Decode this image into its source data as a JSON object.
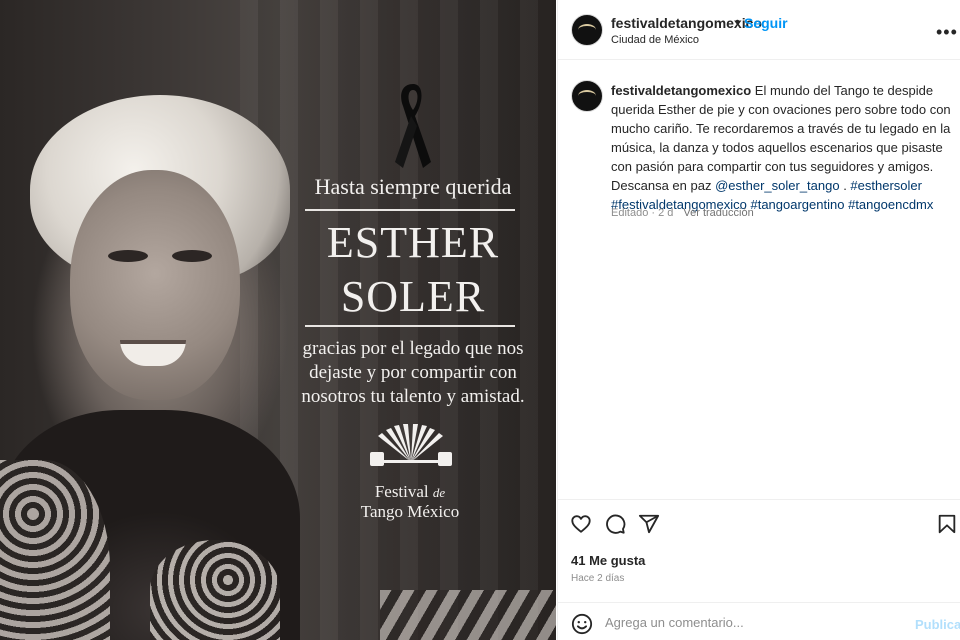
{
  "post": {
    "image": {
      "headline": "Hasta siempre querida",
      "name_line1": "ESTHER",
      "name_line2": "SOLER",
      "tribute": "gracias por el legado que nos dejaste y por compartir con nosotros tu talento y amistad.",
      "logo_line1": "Festival",
      "logo_de": "de",
      "logo_line2": "Tango México"
    },
    "header": {
      "username": "festivaldetangomexico",
      "separator": "•",
      "follow_label": "Seguir",
      "location": "Ciudad de México",
      "more_label": "•••"
    },
    "caption": {
      "username": "festivaldetangomexico",
      "text": " El mundo del Tango te despide querida Esther de pie y con ovaciones pero sobre todo con mucho cariño. Te recordaremos a través de tu legado en la música, la danza y todos aquellos escenarios que pisaste con pasión para compartir con tus seguidores y amigos. Descansa en paz ",
      "mention": "@esther_soler_tango",
      "between": " . ",
      "hashtag1": "#esthersoler",
      "hashtag2": "#festivaldetangomexico",
      "hashtag3": "#tangoargentino",
      "hashtag4": "#tangoencdmx",
      "edited": "Editado · 2 d",
      "translate": "Ver traducción"
    },
    "likes": "41 Me gusta",
    "time_ago": "Hace 2 días",
    "comment": {
      "placeholder": "Agrega un comentario...",
      "publish_label": "Publicar"
    },
    "colors": {
      "accent": "#0095f6",
      "link": "#00376b",
      "publish_disabled": "#b2dffc"
    },
    "icons": [
      "heart-icon",
      "comment-icon",
      "share-icon",
      "bookmark-icon",
      "emoji-icon"
    ]
  }
}
